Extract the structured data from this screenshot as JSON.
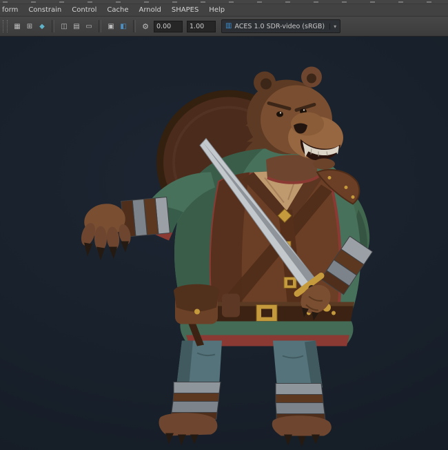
{
  "window": {
    "viewport_bg": "#18202b",
    "chrome_bg": "#424242",
    "accent_blue": "#3d8fd1"
  },
  "menu_bar": {
    "items": [
      {
        "label": "form"
      },
      {
        "label": "Constrain"
      },
      {
        "label": "Control"
      },
      {
        "label": "Cache"
      },
      {
        "label": "Arnold"
      },
      {
        "label": "SHAPES"
      },
      {
        "label": "Help"
      }
    ]
  },
  "toolbar": {
    "icon_groups": {
      "group_a": [
        {
          "name": "select-mode-icon",
          "glyph": "▦"
        },
        {
          "name": "snap-to-grid-icon",
          "glyph": "⊞"
        },
        {
          "name": "snap-to-point-icon",
          "glyph": "◆",
          "color": "#5fb3c9"
        }
      ],
      "group_b": [
        {
          "name": "construction-history-icon",
          "glyph": "◫"
        },
        {
          "name": "render-icon",
          "glyph": "▤"
        },
        {
          "name": "ipr-render-icon",
          "glyph": "▭"
        }
      ],
      "group_c": [
        {
          "name": "resolution-gate-icon",
          "glyph": "▣"
        },
        {
          "name": "gate-mask-icon",
          "glyph": "◧",
          "color": "#4a90c4"
        }
      ]
    },
    "gear_glyph": "⚙",
    "exposure_value": "0.00",
    "gamma_value": "1.00",
    "view_transform": {
      "icon_glyph": "▥",
      "label": "ACES 1.0 SDR-video (sRGB)",
      "caret": "▾"
    }
  }
}
